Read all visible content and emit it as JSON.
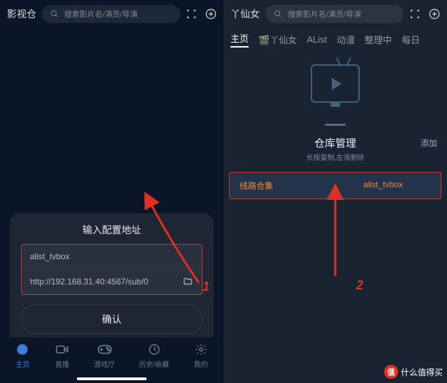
{
  "left": {
    "app_title": "影视仓",
    "search_placeholder": "搜索影片名/演员/导演",
    "modal": {
      "title": "输入配置地址",
      "name_value": "alist_tvbox",
      "url_value": "http://192.168.31.40:4567/sub/0",
      "confirm": "确认"
    },
    "nav": [
      {
        "label": "主页",
        "icon": "globe"
      },
      {
        "label": "直播",
        "icon": "video"
      },
      {
        "label": "游戏厅",
        "icon": "gamepad"
      },
      {
        "label": "历史/收藏",
        "icon": "clock"
      },
      {
        "label": "我的",
        "icon": "gear"
      }
    ],
    "annotation": "1"
  },
  "right": {
    "app_title": "丫仙女",
    "search_placeholder": "搜索影片名/演员/导演",
    "tabs": [
      "主页",
      "🎬丫仙女",
      "AList",
      "动漫",
      "整理中",
      "每日"
    ],
    "repo": {
      "title": "仓库管理",
      "subtitle": "长按复制,左滑删除",
      "add": "添加",
      "col1": "线路合集",
      "col2": "alist_tvbox"
    },
    "annotation": "2"
  },
  "watermark": {
    "badge": "值",
    "text": "什么值得买"
  }
}
